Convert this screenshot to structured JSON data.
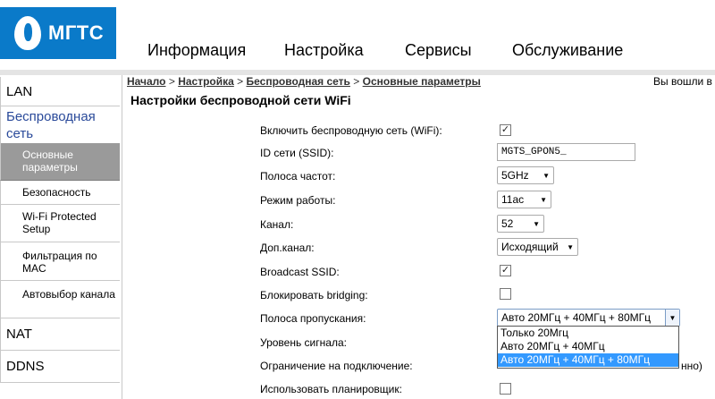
{
  "brand": {
    "name": "МГТС",
    "color": "#0a7ac9"
  },
  "topnav": [
    {
      "label": "Информация"
    },
    {
      "label": "Настройка"
    },
    {
      "label": "Сервисы"
    },
    {
      "label": "Обслуживание"
    }
  ],
  "sidebar": {
    "lan": "LAN",
    "wireless": "Беспроводная сеть",
    "wireless_sub": [
      {
        "label": "Основные параметры",
        "active": true
      },
      {
        "label": "Безопасность"
      },
      {
        "label": "Wi-Fi Protected Setup"
      },
      {
        "label": "Фильтрация по MAC"
      },
      {
        "label": "Автовыбор канала"
      }
    ],
    "nat": "NAT",
    "ddns": "DDNS"
  },
  "breadcrumb": {
    "items": [
      "Начало",
      "Настройка",
      "Беспроводная сеть",
      "Основные параметры"
    ],
    "separator": ">"
  },
  "login_note": "Вы вошли в с",
  "page_title": "Настройки беспроводной сети WiFi",
  "form": {
    "enable_wifi": {
      "label": "Включить беспроводную сеть (WiFi):",
      "checked": true
    },
    "ssid": {
      "label": "ID сети (SSID):",
      "value": "MGTS_GPON5_"
    },
    "band": {
      "label": "Полоса частот:",
      "value": "5GHz"
    },
    "mode": {
      "label": "Режим работы:",
      "value": "11ac"
    },
    "channel": {
      "label": "Канал:",
      "value": "52"
    },
    "ext_channel": {
      "label": "Доп.канал:",
      "value": "Исходящий"
    },
    "broadcast_ssid": {
      "label": "Broadcast SSID:",
      "checked": true
    },
    "block_bridging": {
      "label": "Блокировать bridging:",
      "checked": false
    },
    "bandwidth": {
      "label": "Полоса пропускания:",
      "value": "Авто 20МГц + 40МГц + 80МГц",
      "options": [
        "Только 20Мгц",
        "Авто 20МГц + 40МГц",
        "Авто 20МГц + 40МГц + 80МГц"
      ],
      "selected_index": 2
    },
    "signal_level": {
      "label": "Уровень сигнала:"
    },
    "connection_limit": {
      "label": "Ограничение на подключение:",
      "suffix_partial": "нно)"
    },
    "scheduler": {
      "label": "Использовать планировщик:",
      "checked": false
    }
  }
}
